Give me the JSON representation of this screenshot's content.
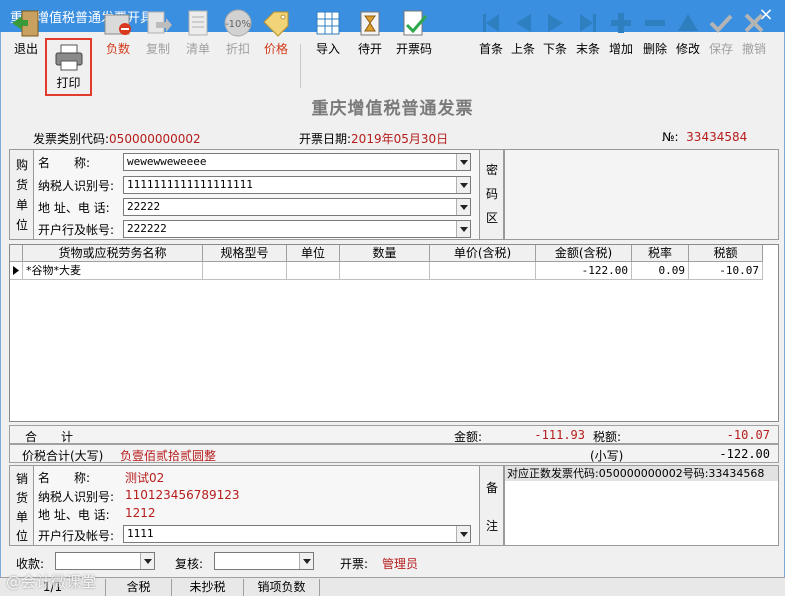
{
  "window": {
    "title": "重庆增值税普通发票开具",
    "close": "×"
  },
  "toolbar": {
    "exit": "退出",
    "print": "打印",
    "negative": "负数",
    "copy": "复制",
    "list": "清单",
    "discount": "折扣",
    "discount_badge": "-10%",
    "price": "价格",
    "import": "导入",
    "pending": "待开",
    "invoice_code": "开票码",
    "first": "首条",
    "prev": "上条",
    "next": "下条",
    "last": "末条",
    "add": "增加",
    "delete": "删除",
    "modify": "修改",
    "save": "保存",
    "undo": "撤销"
  },
  "invoice": {
    "title": "重庆增值税普通发票",
    "category_label": "发票类别代码:",
    "category_value": "050000000002",
    "date_label": "开票日期:",
    "date_value": "2019年05月30日",
    "no_label": "№:",
    "no_value": "33434584"
  },
  "buyer": {
    "section_chars": [
      "购",
      "货",
      "单",
      "位"
    ],
    "name_label": "名　　称:",
    "name_value": "wewewweweeee",
    "tax_label": "纳税人识别号:",
    "tax_value": "1111111111111111111",
    "addr_label": "地 址、电 话:",
    "addr_value": "22222",
    "bank_label": "开户行及帐号:",
    "bank_value": "222222",
    "cipher_chars": [
      "密",
      "码",
      "区"
    ]
  },
  "table": {
    "headers": [
      "货物或应税劳务名称",
      "规格型号",
      "单位",
      "数量",
      "单价(含税)",
      "金额(含税)",
      "税率",
      "税额"
    ],
    "rows": [
      {
        "name": "*谷物*大麦",
        "spec": "",
        "unit": "",
        "qty": "",
        "price": "",
        "amount": "-122.00",
        "rate": "0.09",
        "tax": "-10.07"
      }
    ]
  },
  "totals": {
    "sum_label": "合　　计",
    "amount_label": "金额:",
    "amount_value": "-111.93",
    "tax_label": "税额:",
    "tax_value": "-10.07",
    "words_label": "价税合计(大写)",
    "words_value": "负壹佰贰拾贰圆整",
    "small_label": "(小写)",
    "small_value": "-122.00"
  },
  "seller": {
    "section_chars": [
      "销",
      "货",
      "单",
      "位"
    ],
    "name_label": "名　　称:",
    "name_value": "测试02",
    "tax_label": "纳税人识别号:",
    "tax_value": "110123456789123",
    "addr_label": "地 址、电 话:",
    "addr_value": "1212",
    "bank_label": "开户行及帐号:",
    "bank_value": "1111",
    "remark_chars": [
      "备",
      "注"
    ],
    "remark_text": "对应正数发票代码:050000000002号码:33434568"
  },
  "footer": {
    "payee_label": "收款:",
    "reviewer_label": "复核:",
    "drawer_label": "开票:",
    "drawer_value": "管理员"
  },
  "status": {
    "page": "1/1",
    "tabs": [
      "含税",
      "未抄税",
      "销项负数"
    ]
  },
  "watermark": "@会计微课堂"
}
